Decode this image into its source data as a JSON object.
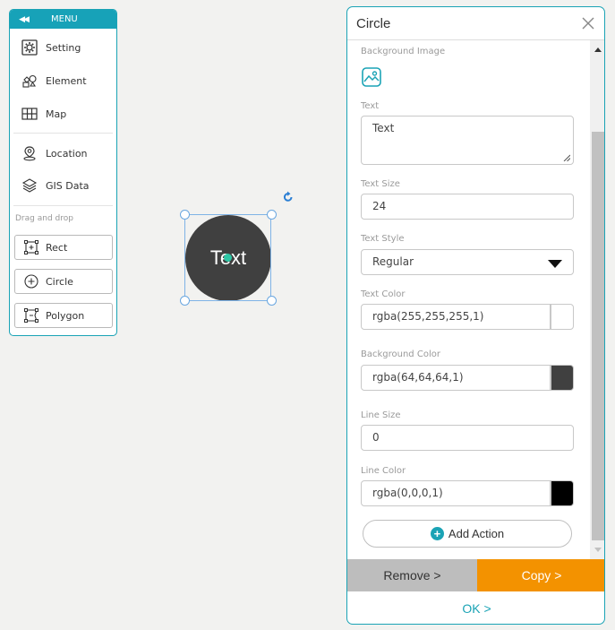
{
  "menu": {
    "title": "MENU",
    "items": [
      {
        "label": "Setting",
        "icon": "gear-icon"
      },
      {
        "label": "Element",
        "icon": "element-icon"
      },
      {
        "label": "Map",
        "icon": "map-icon"
      },
      {
        "label": "Location",
        "icon": "location-pin-icon"
      },
      {
        "label": "GIS Data",
        "icon": "layers-icon"
      }
    ],
    "drag_drop_label": "Drag and drop",
    "shapes": [
      {
        "label": "Rect",
        "icon": "rect-icon"
      },
      {
        "label": "Circle",
        "icon": "circle-plus-icon"
      },
      {
        "label": "Polygon",
        "icon": "polygon-icon"
      }
    ]
  },
  "canvas": {
    "shape_text": "Text",
    "fill_color": "#404040",
    "selection_color": "#6aa7e0",
    "center_color": "#2fc7a6"
  },
  "panel": {
    "title": "Circle",
    "background_image_label": "Background Image",
    "text_label": "Text",
    "text_value": "Text",
    "text_size_label": "Text Size",
    "text_size_value": "24",
    "text_style_label": "Text Style",
    "text_style_value": "Regular",
    "text_color_label": "Text Color",
    "text_color_value": "rgba(255,255,255,1)",
    "text_color_swatch": "#ffffff",
    "background_color_label": "Background Color",
    "background_color_value": "rgba(64,64,64,1)",
    "background_color_swatch": "#404040",
    "line_size_label": "Line Size",
    "line_size_value": "0",
    "line_color_label": "Line Color",
    "line_color_value": "rgba(0,0,0,1)",
    "line_color_swatch": "#000000",
    "add_action_label": "Add Action",
    "remove_label": "Remove >",
    "copy_label": "Copy >",
    "ok_label": "OK >"
  },
  "colors": {
    "accent": "#1aa3b5",
    "copy_button": "#f39200",
    "remove_button": "#bdbdbd"
  }
}
